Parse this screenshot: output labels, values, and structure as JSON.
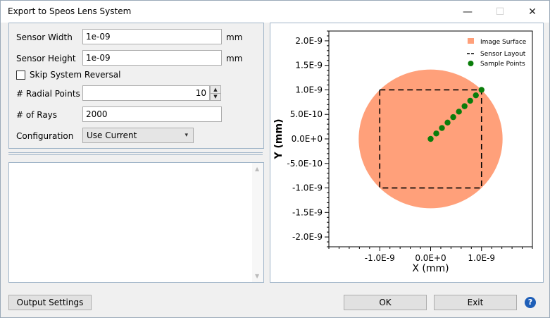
{
  "window": {
    "title": "Export to Speos Lens System",
    "minimize_glyph": "—",
    "maximize_glyph": "☐",
    "close_glyph": "✕"
  },
  "form": {
    "sensor_width": {
      "label": "Sensor Width",
      "value": "1e-09",
      "unit": "mm"
    },
    "sensor_height": {
      "label": "Sensor Height",
      "value": "1e-09",
      "unit": "mm"
    },
    "skip_reversal": {
      "label": "Skip System Reversal",
      "checked": false
    },
    "radial_points": {
      "label": "# Radial Points",
      "value": "10"
    },
    "num_rays": {
      "label": "# of Rays",
      "value": "2000"
    },
    "configuration": {
      "label": "Configuration",
      "selected": "Use Current"
    }
  },
  "buttons": {
    "output_settings": "Output Settings",
    "ok": "OK",
    "exit": "Exit",
    "help": "?"
  },
  "chart_data": {
    "type": "scatter",
    "xlabel": "X (mm)",
    "ylabel": "Y (mm)",
    "xlim": [
      -2e-09,
      2e-09
    ],
    "ylim": [
      -2.2e-09,
      2.2e-09
    ],
    "x_ticks": [
      -1e-09,
      0,
      1e-09
    ],
    "x_tick_labels": [
      "-1.0E-9",
      "0.0E+0",
      "1.0E-9"
    ],
    "y_ticks": [
      2e-09,
      1.5e-09,
      1e-09,
      5e-10,
      0,
      -5e-10,
      -1e-09,
      -1.5e-09,
      -2e-09
    ],
    "y_tick_labels": [
      "2.0E-9",
      "1.5E-9",
      "1.0E-9",
      "5.0E-10",
      "0.0E+0",
      "-5.0E-10",
      "-1.0E-9",
      "-1.5E-9",
      "-2.0E-9"
    ],
    "grid": false,
    "legend_position": "top-right",
    "image_surface": {
      "name": "Image Surface",
      "radius": 1.414e-09,
      "color": "#ffa07a"
    },
    "sensor_layout": {
      "name": "Sensor Layout",
      "xmin": -1e-09,
      "xmax": 1e-09,
      "ymin": -1e-09,
      "ymax": 1e-09,
      "color": "#000000"
    },
    "sample_points": {
      "name": "Sample Points",
      "color": "#0a7d0a",
      "x": [
        0,
        1.11e-10,
        2.22e-10,
        3.33e-10,
        4.44e-10,
        5.56e-10,
        6.67e-10,
        7.78e-10,
        8.89e-10,
        1e-09
      ],
      "y": [
        0,
        1.11e-10,
        2.22e-10,
        3.33e-10,
        4.44e-10,
        5.56e-10,
        6.67e-10,
        7.78e-10,
        8.89e-10,
        1e-09
      ]
    }
  }
}
